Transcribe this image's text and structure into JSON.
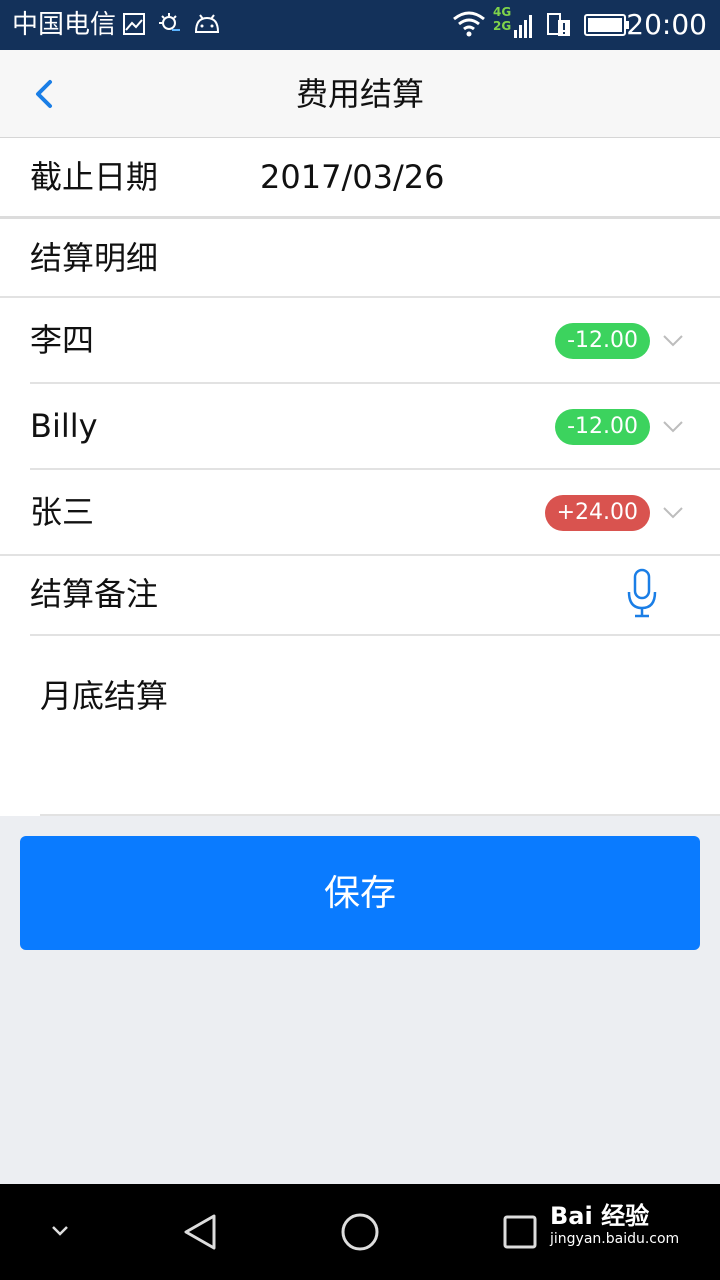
{
  "status_bar": {
    "carrier": "中国电信",
    "network_4g": "4G",
    "network_2g": "2G",
    "time": "20:00"
  },
  "header": {
    "title": "费用结算"
  },
  "form": {
    "date_label": "截止日期",
    "date_value": "2017/03/26",
    "detail_label": "结算明细",
    "details": [
      {
        "name": "李四",
        "amount": "-12.00",
        "type": "negative"
      },
      {
        "name": "Billy",
        "amount": "-12.00",
        "type": "negative"
      },
      {
        "name": "张三",
        "amount": "+24.00",
        "type": "positive"
      }
    ],
    "note_label": "结算备注",
    "note_value": "月底结算"
  },
  "actions": {
    "save_label": "保存"
  },
  "watermark": {
    "main": "Bai 经验",
    "sub": "jingyan.baidu.com"
  },
  "colors": {
    "accent": "#0a7bff",
    "negative_badge": "#3cd35e",
    "positive_badge": "#d9534f",
    "status_bar": "#13315a"
  }
}
